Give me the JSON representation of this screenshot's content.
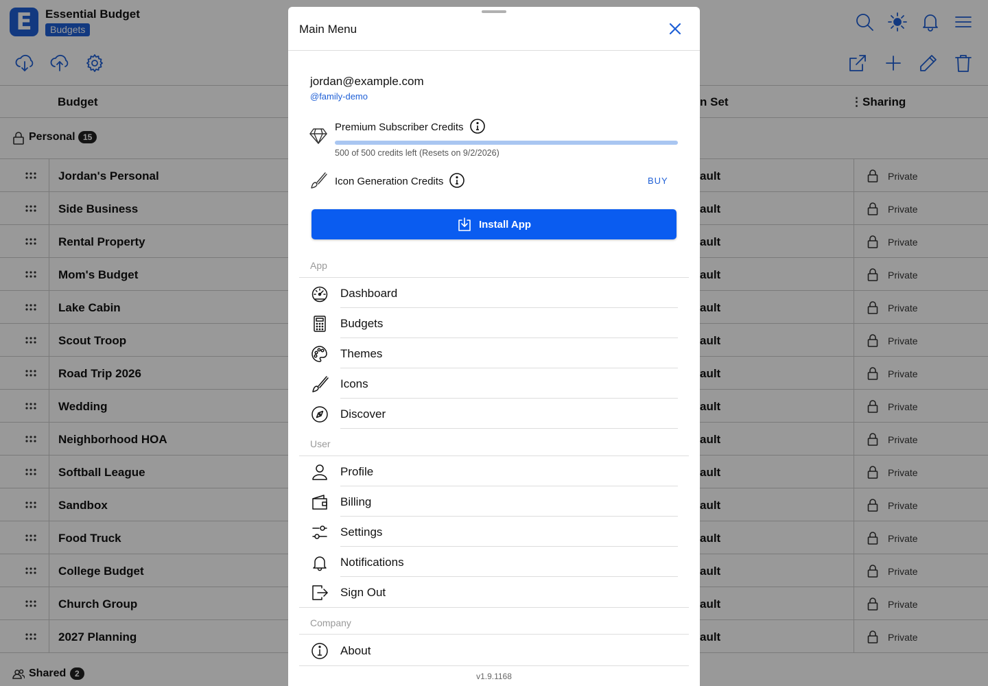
{
  "app": {
    "title": "Essential Budget",
    "badge": "Budgets",
    "logo_letter": "E",
    "accent_color": "#1e5fd6"
  },
  "toolbar": {
    "left_icons": [
      "cloud-download-icon",
      "cloud-upload-icon",
      "gear-icon"
    ],
    "right_icons": [
      "external-link-icon",
      "plus-icon",
      "pencil-icon",
      "trash-icon"
    ],
    "top_icons": [
      "search-icon",
      "sun-icon",
      "bell-icon",
      "hamburger-menu-icon"
    ]
  },
  "table": {
    "col_budget": "Budget",
    "col_set": "n Set",
    "col_sharing": "Sharing",
    "group_personal": {
      "label": "Personal",
      "count": "15"
    },
    "group_shared": {
      "label": "Shared",
      "count": "2"
    },
    "theme_value": "ault",
    "sharing_value": "Private",
    "rows": [
      "Jordan's Personal",
      "Side Business",
      "Rental Property",
      "Mom's Budget",
      "Lake Cabin",
      "Scout Troop",
      "Road Trip 2026",
      "Wedding",
      "Neighborhood HOA",
      "Softball League",
      "Sandbox",
      "Food Truck",
      "College Budget",
      "Church Group",
      "2027 Planning"
    ]
  },
  "menu": {
    "title": "Main Menu",
    "email": "jordan@example.com",
    "handle": "@family-demo",
    "premium": {
      "title": "Premium Subscriber Credits",
      "subtitle": "500 of 500 credits left (Resets on 9/2/2026)",
      "fraction_used_remaining": 1.0
    },
    "icon_credits": {
      "title": "Icon Generation Credits",
      "action": "BUY"
    },
    "install_label": "Install App",
    "section_app": "App",
    "app_items": [
      {
        "label": "Dashboard",
        "icon": "gauge-icon"
      },
      {
        "label": "Budgets",
        "icon": "calculator-icon"
      },
      {
        "label": "Themes",
        "icon": "palette-icon"
      },
      {
        "label": "Icons",
        "icon": "paintbrush-icon"
      },
      {
        "label": "Discover",
        "icon": "compass-icon"
      }
    ],
    "section_user": "User",
    "user_items": [
      {
        "label": "Profile",
        "icon": "person-icon"
      },
      {
        "label": "Billing",
        "icon": "wallet-icon"
      },
      {
        "label": "Settings",
        "icon": "sliders-icon"
      },
      {
        "label": "Notifications",
        "icon": "bell-icon"
      },
      {
        "label": "Sign Out",
        "icon": "sign-out-icon"
      }
    ],
    "section_company": "Company",
    "company_items": [
      {
        "label": "About",
        "icon": "info-icon"
      }
    ],
    "version": "v1.9.1168"
  }
}
